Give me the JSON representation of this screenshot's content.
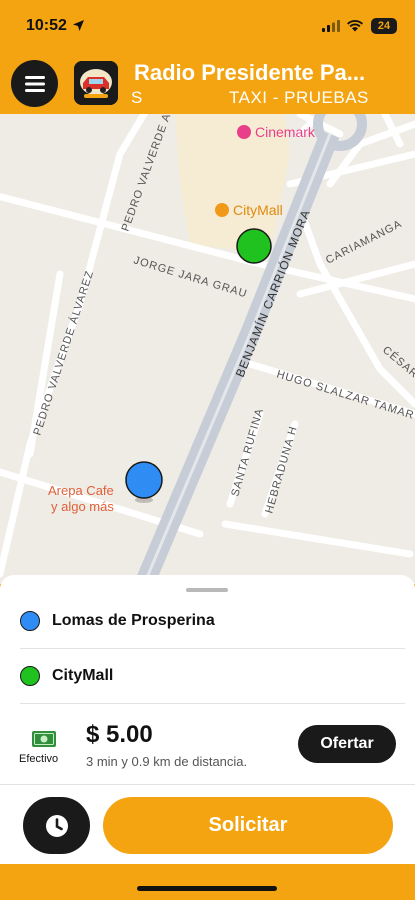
{
  "status_bar": {
    "time": "10:52",
    "battery": "24"
  },
  "header": {
    "title": "Radio Presidente Pa...",
    "subtitle_fragment": "S",
    "subtitle": "TAXI - PRUEBAS"
  },
  "map": {
    "places": {
      "cinemark": "Cinemark",
      "citymall": "CityMall",
      "arepa_line1": "Arepa Cafe",
      "arepa_line2": "y algo más"
    },
    "streets": {
      "pedro_valverde_top": "PEDRO VALVERDE A",
      "pedro_valverde_alvarez": "PEDRO VALVERDE ÁLVAREZ",
      "jorge_jara_grau": "JORGE JARA GRAU",
      "benjamin_carrion_mora": "BENJAMÍN CARRIÓN MORA",
      "cariamanga": "CARIAMANGA",
      "cesar_b": "CÉSAR B",
      "hugo_salazar_tamariz": "HUGO SLALZAR TAMAR",
      "santa_rufina": "SANTA RUFINA",
      "hebraduna": "HEBRADUNA H"
    },
    "colors": {
      "origin_pin": "#2f8cf5",
      "destination_pin": "#1fc21f"
    }
  },
  "trip": {
    "origin": "Lomas de Prosperina",
    "destination": "CityMall",
    "payment_method": "Efectivo",
    "price": "$ 5.00",
    "eta": "3 min y 0.9 km de distancia.",
    "offer_label": "Ofertar",
    "request_label": "Solicitar"
  },
  "icons": {
    "menu": "hamburger-menu-icon",
    "schedule": "clock-icon",
    "payment": "cash-icon",
    "location": "location-arrow-icon"
  },
  "colors": {
    "accent": "#f3a410",
    "dark": "#1a1a1a"
  }
}
